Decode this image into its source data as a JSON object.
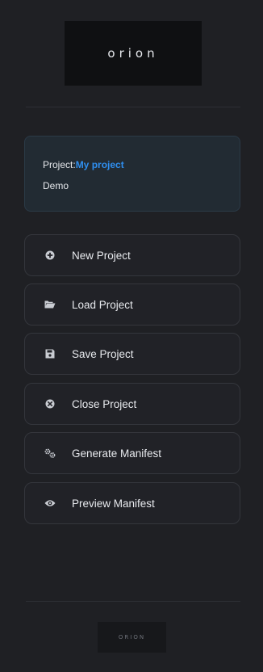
{
  "brand": {
    "logo_text": "orion",
    "footer_logo_text": "ORION"
  },
  "project": {
    "label": "Project:",
    "name": "My project",
    "subtitle": "Demo"
  },
  "menu": {
    "items": [
      {
        "label": "New Project",
        "icon": "plus-circle-icon"
      },
      {
        "label": "Load Project",
        "icon": "folder-open-icon"
      },
      {
        "label": "Save Project",
        "icon": "floppy-disk-icon"
      },
      {
        "label": "Close Project",
        "icon": "close-circle-icon"
      },
      {
        "label": "Generate Manifest",
        "icon": "gears-icon"
      },
      {
        "label": "Preview Manifest",
        "icon": "eye-icon"
      }
    ]
  },
  "colors": {
    "background": "#1f2024",
    "accent": "#2f8ff0",
    "card_bg": "#222b33",
    "button_border": "#34363c"
  }
}
